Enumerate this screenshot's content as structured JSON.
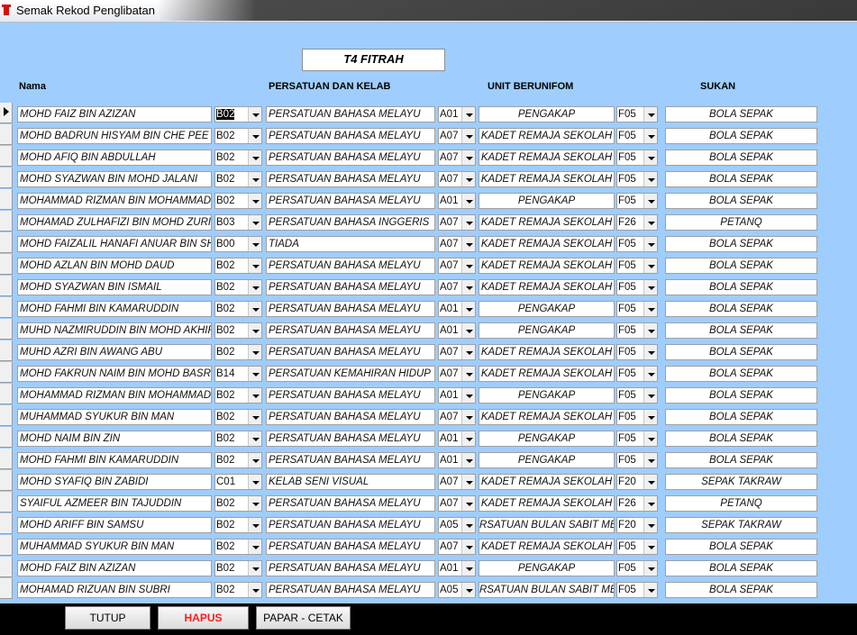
{
  "window": {
    "title": "Semak Rekod Penglibatan"
  },
  "form": {
    "title": "T4 FITRAH"
  },
  "headers": {
    "nama": "Nama",
    "persatuan": "PERSATUAN DAN KELAB",
    "unit": "UNIT BERUNIFOM",
    "sukan": "SUKAN"
  },
  "rows": [
    {
      "nama": "MOHD FAIZ BIN AZIZAN",
      "kod_p": "B02",
      "persatuan": "PERSATUAN BAHASA MELAYU",
      "kod_u": "A01",
      "unit": "PENGAKAP",
      "kod_s": "F05",
      "sukan": "BOLA SEPAK"
    },
    {
      "nama": "MOHD BADRUN HISYAM BIN CHE PEE",
      "kod_p": "B02",
      "persatuan": "PERSATUAN BAHASA MELAYU",
      "kod_u": "A07",
      "unit": "KADET REMAJA SEKOLAH",
      "kod_s": "F05",
      "sukan": "BOLA SEPAK"
    },
    {
      "nama": "MOHD AFIQ BIN ABDULLAH",
      "kod_p": "B02",
      "persatuan": "PERSATUAN BAHASA MELAYU",
      "kod_u": "A07",
      "unit": "KADET REMAJA SEKOLAH",
      "kod_s": "F05",
      "sukan": "BOLA SEPAK"
    },
    {
      "nama": "MOHD SYAZWAN BIN MOHD JALANI",
      "kod_p": "B02",
      "persatuan": "PERSATUAN BAHASA MELAYU",
      "kod_u": "A07",
      "unit": "KADET REMAJA SEKOLAH",
      "kod_s": "F05",
      "sukan": "BOLA SEPAK"
    },
    {
      "nama": "MOHAMMAD RIZMAN BIN MOHAMMAD SA",
      "kod_p": "B02",
      "persatuan": "PERSATUAN BAHASA MELAYU",
      "kod_u": "A01",
      "unit": "PENGAKAP",
      "kod_s": "F05",
      "sukan": "BOLA SEPAK"
    },
    {
      "nama": "MOHAMAD ZULHAFIZI BIN MOHD ZURI",
      "kod_p": "B03",
      "persatuan": "PERSATUAN BAHASA INGGERIS",
      "kod_u": "A07",
      "unit": "KADET REMAJA SEKOLAH",
      "kod_s": "F26",
      "sukan": "PETANQ"
    },
    {
      "nama": "MOHD FAIZALIL HANAFI ANUAR BIN SHU",
      "kod_p": "B00",
      "persatuan": "TIADA",
      "kod_u": "A07",
      "unit": "KADET REMAJA SEKOLAH",
      "kod_s": "F05",
      "sukan": "BOLA SEPAK"
    },
    {
      "nama": "MOHD AZLAN BIN MOHD DAUD",
      "kod_p": "B02",
      "persatuan": "PERSATUAN BAHASA MELAYU",
      "kod_u": "A07",
      "unit": "KADET REMAJA SEKOLAH",
      "kod_s": "F05",
      "sukan": "BOLA SEPAK"
    },
    {
      "nama": "MOHD SYAZWAN BIN ISMAIL",
      "kod_p": "B02",
      "persatuan": "PERSATUAN BAHASA MELAYU",
      "kod_u": "A07",
      "unit": "KADET REMAJA SEKOLAH",
      "kod_s": "F05",
      "sukan": "BOLA SEPAK"
    },
    {
      "nama": "MOHD FAHMI BIN KAMARUDDIN",
      "kod_p": "B02",
      "persatuan": "PERSATUAN BAHASA MELAYU",
      "kod_u": "A01",
      "unit": "PENGAKAP",
      "kod_s": "F05",
      "sukan": "BOLA SEPAK"
    },
    {
      "nama": "MUHD NAZMIRUDDIN BIN MOHD AKHIR",
      "kod_p": "B02",
      "persatuan": "PERSATUAN BAHASA MELAYU",
      "kod_u": "A01",
      "unit": "PENGAKAP",
      "kod_s": "F05",
      "sukan": "BOLA SEPAK"
    },
    {
      "nama": "MUHD AZRI BIN AWANG ABU",
      "kod_p": "B02",
      "persatuan": "PERSATUAN BAHASA MELAYU",
      "kod_u": "A07",
      "unit": "KADET REMAJA SEKOLAH",
      "kod_s": "F05",
      "sukan": "BOLA SEPAK"
    },
    {
      "nama": "MOHD FAKRUN NAIM BIN MOHD BASRI",
      "kod_p": "B14",
      "persatuan": "PERSATUAN KEMAHIRAN HIDUP",
      "kod_u": "A07",
      "unit": "KADET REMAJA SEKOLAH",
      "kod_s": "F05",
      "sukan": "BOLA SEPAK"
    },
    {
      "nama": "MOHAMMAD RIZMAN BIN MOHAMMAD SA",
      "kod_p": "B02",
      "persatuan": "PERSATUAN BAHASA MELAYU",
      "kod_u": "A01",
      "unit": "PENGAKAP",
      "kod_s": "F05",
      "sukan": "BOLA SEPAK"
    },
    {
      "nama": "MUHAMMAD SYUKUR BIN MAN",
      "kod_p": "B02",
      "persatuan": "PERSATUAN BAHASA MELAYU",
      "kod_u": "A07",
      "unit": "KADET REMAJA SEKOLAH",
      "kod_s": "F05",
      "sukan": "BOLA SEPAK"
    },
    {
      "nama": "MOHD NAIM BIN ZIN",
      "kod_p": "B02",
      "persatuan": "PERSATUAN BAHASA MELAYU",
      "kod_u": "A01",
      "unit": "PENGAKAP",
      "kod_s": "F05",
      "sukan": "BOLA SEPAK"
    },
    {
      "nama": "MOHD FAHMI BIN KAMARUDDIN",
      "kod_p": "B02",
      "persatuan": "PERSATUAN BAHASA MELAYU",
      "kod_u": "A01",
      "unit": "PENGAKAP",
      "kod_s": "F05",
      "sukan": "BOLA SEPAK"
    },
    {
      "nama": "MOHD SYAFIQ BIN ZABIDI",
      "kod_p": "C01",
      "persatuan": "KELAB SENI VISUAL",
      "kod_u": "A07",
      "unit": "KADET REMAJA SEKOLAH",
      "kod_s": "F20",
      "sukan": "SEPAK TAKRAW"
    },
    {
      "nama": "SYAIFUL AZMEER BIN TAJUDDIN",
      "kod_p": "B02",
      "persatuan": "PERSATUAN BAHASA MELAYU",
      "kod_u": "A07",
      "unit": "KADET REMAJA SEKOLAH",
      "kod_s": "F26",
      "sukan": "PETANQ"
    },
    {
      "nama": "MOHD ARIFF BIN SAMSU",
      "kod_p": "B02",
      "persatuan": "PERSATUAN BAHASA MELAYU",
      "kod_u": "A05",
      "unit": "RSATUAN BULAN SABIT MER",
      "kod_s": "F20",
      "sukan": "SEPAK TAKRAW"
    },
    {
      "nama": "MUHAMMAD SYUKUR BIN MAN",
      "kod_p": "B02",
      "persatuan": "PERSATUAN BAHASA MELAYU",
      "kod_u": "A07",
      "unit": "KADET REMAJA SEKOLAH",
      "kod_s": "F05",
      "sukan": "BOLA SEPAK"
    },
    {
      "nama": "MOHD FAIZ BIN AZIZAN",
      "kod_p": "B02",
      "persatuan": "PERSATUAN BAHASA MELAYU",
      "kod_u": "A01",
      "unit": "PENGAKAP",
      "kod_s": "F05",
      "sukan": "BOLA SEPAK"
    },
    {
      "nama": "MOHAMAD RIZUAN BIN SUBRI",
      "kod_p": "B02",
      "persatuan": "PERSATUAN BAHASA MELAYU",
      "kod_u": "A05",
      "unit": "RSATUAN BULAN SABIT MER",
      "kod_s": "F05",
      "sukan": "BOLA SEPAK"
    }
  ],
  "footer": {
    "tutup": "TUTUP",
    "hapus": "HAPUS",
    "cetak": "PAPAR - CETAK"
  }
}
